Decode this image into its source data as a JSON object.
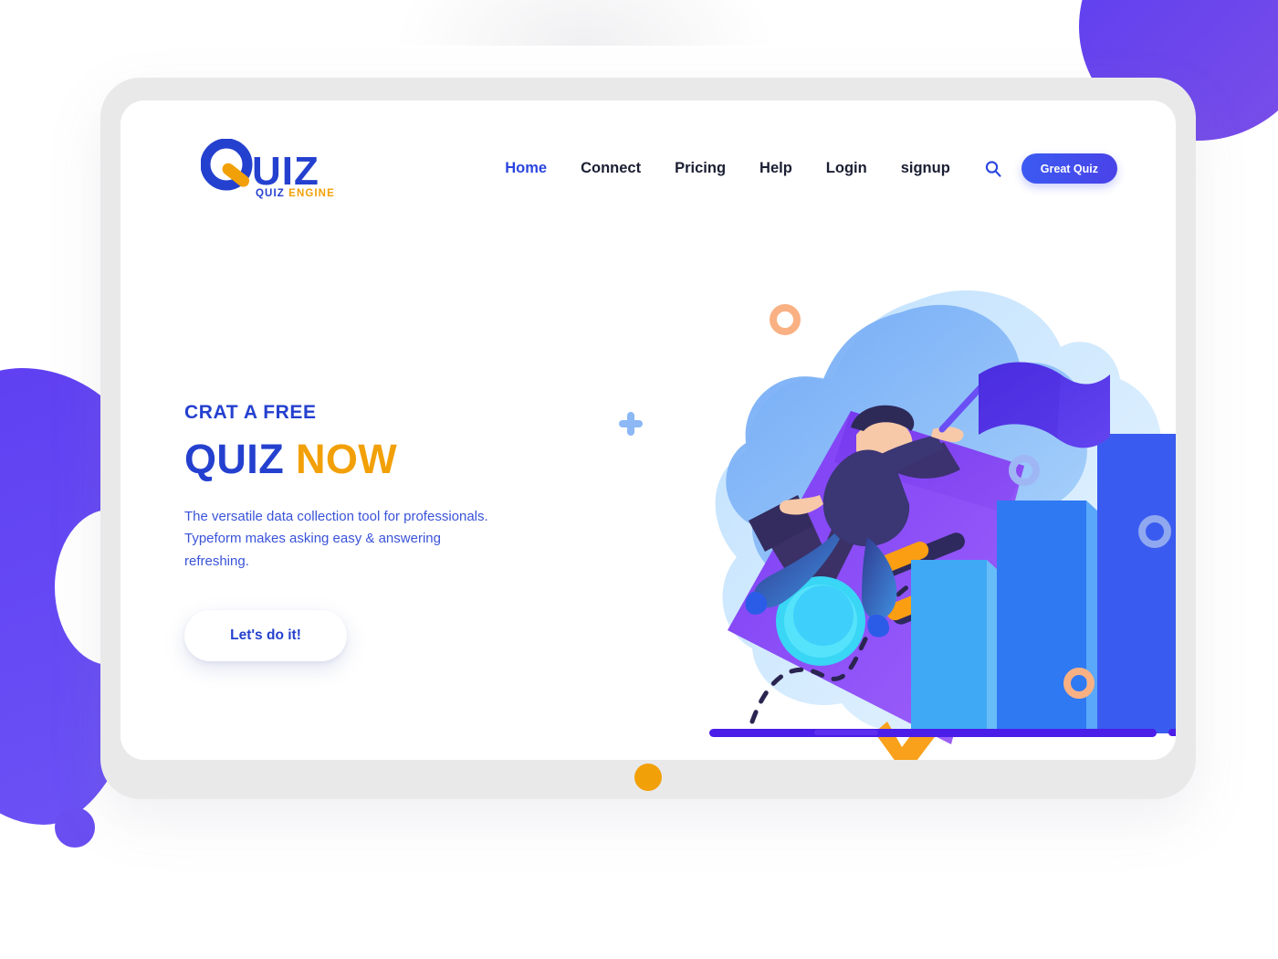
{
  "brand": {
    "logo_word": "UIZ",
    "logo_letter": "Q",
    "tagline_part1": "QUIZ",
    "tagline_part2": "ENGINE",
    "blue": "#2440cf",
    "orange": "#f2a007"
  },
  "nav": {
    "items": [
      {
        "label": "Home",
        "active": true
      },
      {
        "label": "Connect",
        "active": false
      },
      {
        "label": "Pricing",
        "active": false
      },
      {
        "label": "Help",
        "active": false
      },
      {
        "label": "Login",
        "active": false
      },
      {
        "label": "signup",
        "active": false
      }
    ],
    "search_icon": "search-icon",
    "cta_label": "Great Quiz"
  },
  "hero": {
    "eyebrow": "CRAT A FREE",
    "headline_part1": "QUIZ",
    "headline_part2": "NOW",
    "paragraph": "The versatile data collection tool for professionals. Typeform makes asking easy & answering refreshing.",
    "cta_label": "Let's do it!"
  },
  "illustration": {
    "name": "quiz-growth-illustration",
    "elements": [
      "purple-diamond-card",
      "blue-blob-background",
      "running-man-with-flag",
      "bar-chart-3d",
      "dashed-trajectory",
      "cyan-circle",
      "orange-pill-bars",
      "decorative-rings",
      "plus-marks"
    ],
    "bar_colors": [
      "#3fa9f5",
      "#3576f0",
      "#3a56ef"
    ]
  },
  "decor": {
    "tablet_home_dot": "home-indicator-dot",
    "blob_top_right": "#5b3df0",
    "blob_left": "#5f3ff2",
    "dot_bottom_left": "#6a4ef2"
  }
}
